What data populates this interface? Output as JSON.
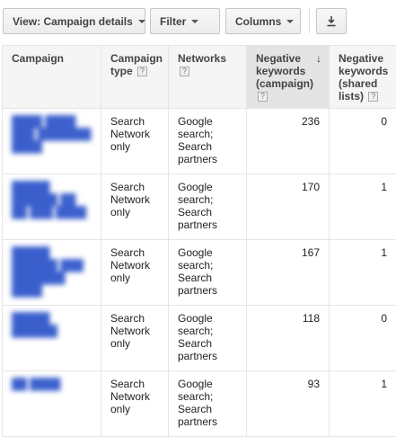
{
  "toolbar": {
    "view_label": "View: Campaign details",
    "filter_label": "Filter",
    "columns_label": "Columns",
    "download_icon": "download-icon"
  },
  "table": {
    "headers": {
      "campaign": "Campaign",
      "campaign_type": "Campaign type",
      "networks": "Networks",
      "neg_kw_campaign": "Negative keywords (campaign)",
      "neg_kw_shared": "Negative keywords (shared lists)"
    },
    "help_glyph": "?",
    "sort_glyph": "↓",
    "rows": [
      {
        "campaign": "████ ████ ███ ███████ ████",
        "type": "Search Network only",
        "networks": "Google search; Search partners",
        "neg_campaign": "236",
        "neg_shared": "0"
      },
      {
        "campaign": "█████ ██████ ██ ██ ███ ████",
        "type": "Search Network only",
        "networks": "Google search; Search partners",
        "neg_campaign": "170",
        "neg_shared": "1"
      },
      {
        "campaign": "█████ ██████ ███ ███████ ████",
        "type": "Search Network only",
        "networks": "Google search; Search partners",
        "neg_campaign": "167",
        "neg_shared": "1"
      },
      {
        "campaign": "█████ ██████",
        "type": "Search Network only",
        "networks": "Google search; Search partners",
        "neg_campaign": "118",
        "neg_shared": "0"
      },
      {
        "campaign": "██ ████",
        "type": "Search Network only",
        "networks": "Google search; Search partners",
        "neg_campaign": "93",
        "neg_shared": "1"
      }
    ]
  }
}
